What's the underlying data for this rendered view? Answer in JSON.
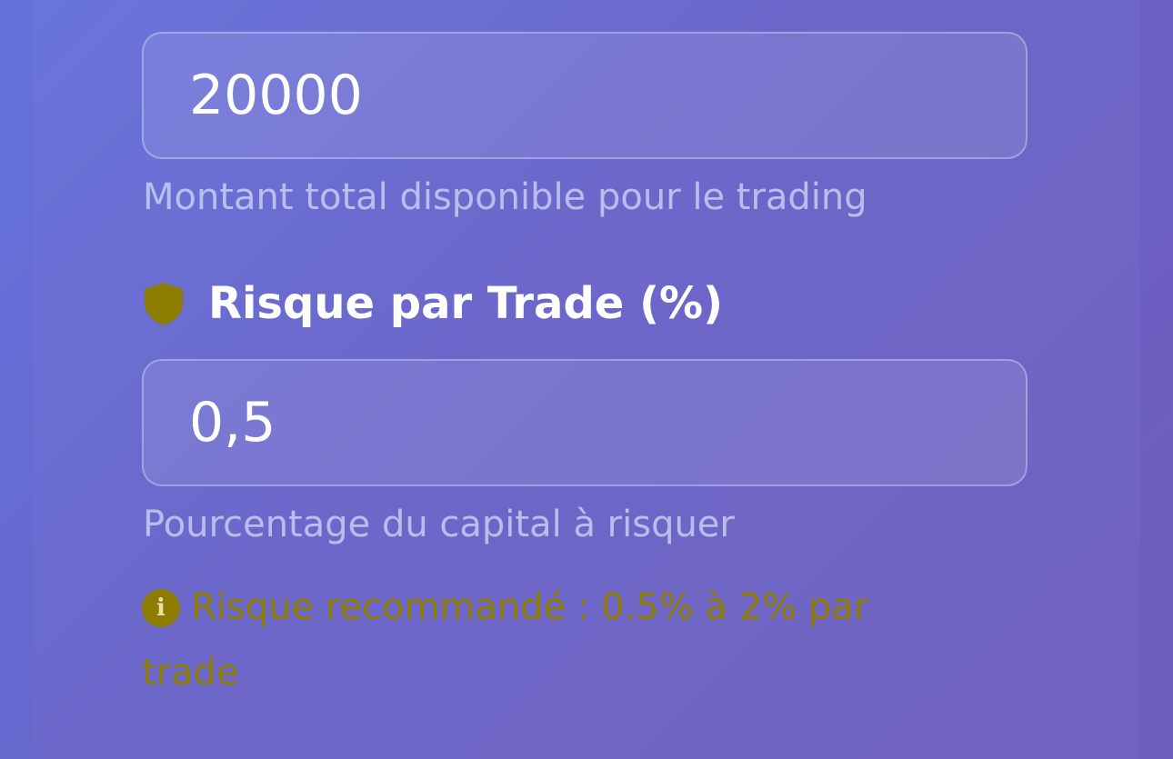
{
  "fields": {
    "capital": {
      "value": "20000",
      "help": "Montant total disponible pour le trading"
    },
    "risk": {
      "label": "Risque par Trade (%)",
      "value": "0,5",
      "help": "Pourcentage du capital à risquer"
    }
  },
  "recommendation": {
    "icon": "info-icon",
    "text": "Risque recommandé : 0.5% à 2% par trade"
  },
  "colors": {
    "background_start": "#6774dc",
    "background_end": "#6f5fbd",
    "accent": "#8c7c00",
    "text": "#ffffff",
    "help_text": "#c8cdf0"
  },
  "icons": {
    "risk_label": "shield-icon",
    "recommendation": "info-icon"
  }
}
